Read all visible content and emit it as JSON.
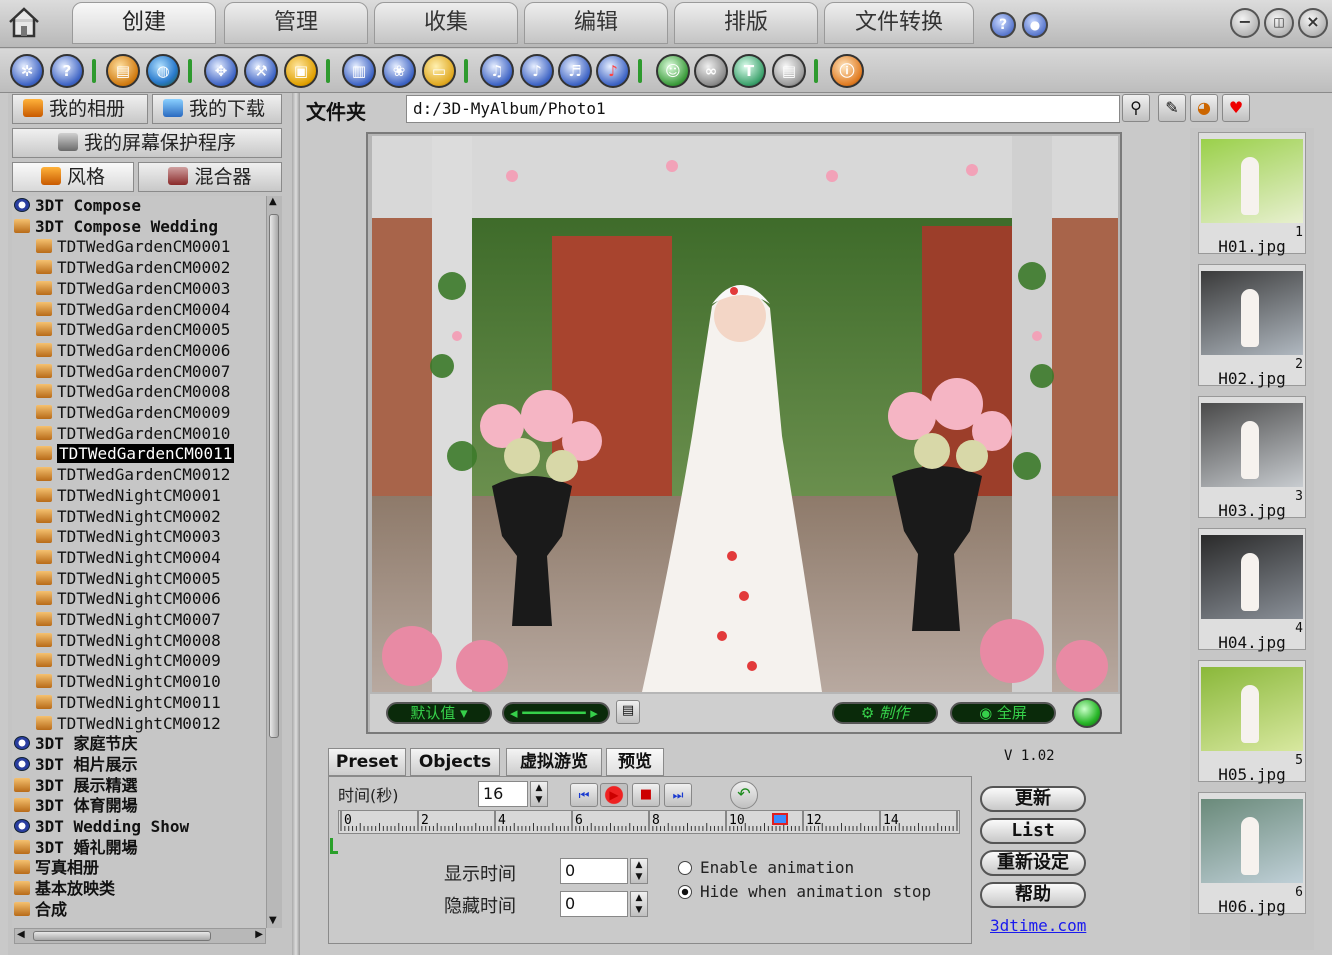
{
  "top_tabs": [
    "创建",
    "管理",
    "收集",
    "编辑",
    "排版",
    "文件转换"
  ],
  "toolbar": {
    "help_glyph": "?",
    "text_tool_glyph": "T"
  },
  "left": {
    "btn_album": "我的相册",
    "btn_download": "我的下载",
    "btn_screensaver": "我的屏幕保护程序",
    "tab_style": "风格",
    "tab_mixer": "混合器",
    "tree": [
      {
        "text": "3DT Compose",
        "icon": "clock",
        "indent": 0,
        "bold": true
      },
      {
        "text": "3DT Compose Wedding",
        "icon": "folder",
        "indent": 0,
        "bold": true
      },
      {
        "text": "TDTWedGardenCM0001",
        "icon": "folder",
        "indent": 1
      },
      {
        "text": "TDTWedGardenCM0002",
        "icon": "folder",
        "indent": 1
      },
      {
        "text": "TDTWedGardenCM0003",
        "icon": "folder",
        "indent": 1
      },
      {
        "text": "TDTWedGardenCM0004",
        "icon": "folder",
        "indent": 1
      },
      {
        "text": "TDTWedGardenCM0005",
        "icon": "folder",
        "indent": 1
      },
      {
        "text": "TDTWedGardenCM0006",
        "icon": "folder",
        "indent": 1
      },
      {
        "text": "TDTWedGardenCM0007",
        "icon": "folder",
        "indent": 1
      },
      {
        "text": "TDTWedGardenCM0008",
        "icon": "folder",
        "indent": 1
      },
      {
        "text": "TDTWedGardenCM0009",
        "icon": "folder",
        "indent": 1
      },
      {
        "text": "TDTWedGardenCM0010",
        "icon": "folder",
        "indent": 1
      },
      {
        "text": "TDTWedGardenCM0011",
        "icon": "folder",
        "indent": 1,
        "selected": true
      },
      {
        "text": "TDTWedGardenCM0012",
        "icon": "folder",
        "indent": 1
      },
      {
        "text": "TDTWedNightCM0001",
        "icon": "folder",
        "indent": 1
      },
      {
        "text": "TDTWedNightCM0002",
        "icon": "folder",
        "indent": 1
      },
      {
        "text": "TDTWedNightCM0003",
        "icon": "folder",
        "indent": 1
      },
      {
        "text": "TDTWedNightCM0004",
        "icon": "folder",
        "indent": 1
      },
      {
        "text": "TDTWedNightCM0005",
        "icon": "folder",
        "indent": 1
      },
      {
        "text": "TDTWedNightCM0006",
        "icon": "folder",
        "indent": 1
      },
      {
        "text": "TDTWedNightCM0007",
        "icon": "folder",
        "indent": 1
      },
      {
        "text": "TDTWedNightCM0008",
        "icon": "folder",
        "indent": 1
      },
      {
        "text": "TDTWedNightCM0009",
        "icon": "folder",
        "indent": 1
      },
      {
        "text": "TDTWedNightCM0010",
        "icon": "folder",
        "indent": 1
      },
      {
        "text": "TDTWedNightCM0011",
        "icon": "folder",
        "indent": 1
      },
      {
        "text": "TDTWedNightCM0012",
        "icon": "folder",
        "indent": 1
      },
      {
        "text": "3DT 家庭节庆",
        "icon": "clock",
        "indent": 0,
        "bold": true
      },
      {
        "text": "3DT 相片展示",
        "icon": "clock",
        "indent": 0,
        "bold": true
      },
      {
        "text": "3DT 展示精選",
        "icon": "folder",
        "indent": 0,
        "bold": true
      },
      {
        "text": "3DT 体育開場",
        "icon": "folder",
        "indent": 0,
        "bold": true
      },
      {
        "text": "3DT Wedding Show",
        "icon": "clock",
        "indent": 0,
        "bold": true
      },
      {
        "text": "3DT 婚礼開場",
        "icon": "folder",
        "indent": 0,
        "bold": true
      },
      {
        "text": "写真相册",
        "icon": "folder",
        "indent": 0,
        "bold": true
      },
      {
        "text": "基本放映类",
        "icon": "folder",
        "indent": 0,
        "bold": true
      },
      {
        "text": "合成",
        "icon": "folder",
        "indent": 0,
        "bold": true
      }
    ]
  },
  "folder": {
    "label": "文件夹",
    "path": "d:/3D-MyAlbum/Photo1"
  },
  "preview": {
    "default_label": "默认值",
    "make_label": "制作",
    "fullscreen_label": "全屏"
  },
  "bottom_tabs": [
    "Preset",
    "Objects",
    "虚拟游览",
    "预览"
  ],
  "version": "V 1.02",
  "timing": {
    "time_label": "时间(秒)",
    "time_value": "16",
    "ticks": [
      "0",
      "2",
      "4",
      "6",
      "8",
      "10",
      "12",
      "14"
    ],
    "show_time_label": "显示时间",
    "show_time_value": "0",
    "hide_time_label": "隐藏时间",
    "hide_time_value": "0",
    "enable_animation": "Enable animation",
    "hide_when_stop": "Hide when animation stop",
    "enable_animation_checked": false,
    "hide_when_stop_checked": true,
    "playhead_seconds": 11.4
  },
  "side_buttons": {
    "update": "更新",
    "list": "List",
    "reset": "重新设定",
    "help": "帮助",
    "link": "3dtime.com"
  },
  "thumbnails": [
    {
      "num": "1",
      "name": "H01.jpg"
    },
    {
      "num": "2",
      "name": "H02.jpg"
    },
    {
      "num": "3",
      "name": "H03.jpg"
    },
    {
      "num": "4",
      "name": "H04.jpg"
    },
    {
      "num": "5",
      "name": "H05.jpg"
    },
    {
      "num": "6",
      "name": "H06.jpg"
    }
  ],
  "colors": {
    "accent_green": "#36d04a",
    "selection": "#000000",
    "link": "#1a1aee"
  }
}
